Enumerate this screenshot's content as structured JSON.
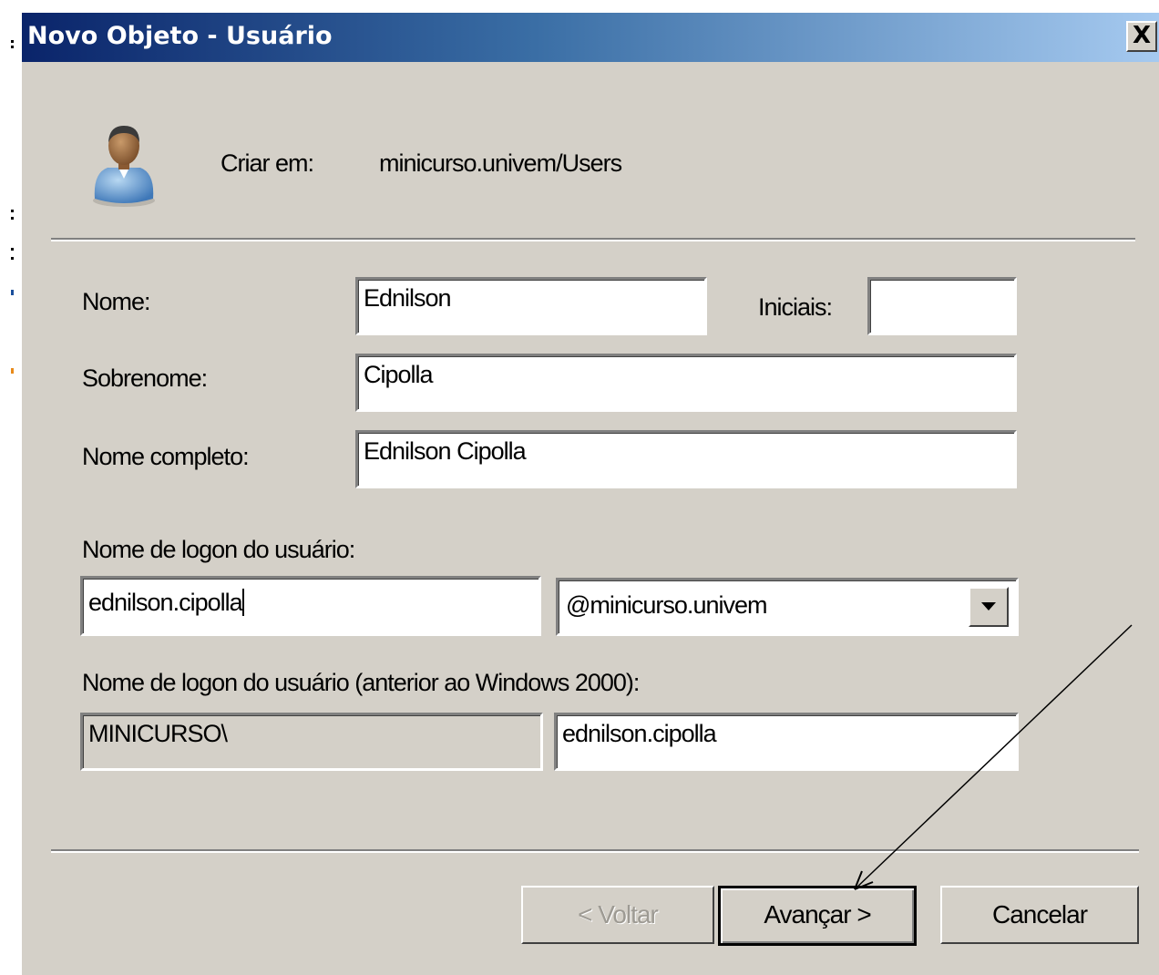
{
  "window": {
    "title": "Novo Objeto - Usuário",
    "close_glyph": "X"
  },
  "header": {
    "icon": "user-icon",
    "create_in_label": "Criar em:",
    "create_in_value": "minicurso.univem/Users"
  },
  "form": {
    "first_name_label": "Nome:",
    "first_name_value": "Ednilson",
    "initials_label": "Iniciais:",
    "initials_value": "",
    "last_name_label": "Sobrenome:",
    "last_name_value": "Cipolla",
    "full_name_label": "Nome completo:",
    "full_name_value": "Ednilson Cipolla",
    "logon_label": "Nome de logon do usuário:",
    "logon_value": "ednilson.cipolla",
    "domain_suffix_value": "@minicurso.univem",
    "pre2000_label": "Nome de logon do usuário (anterior ao Windows 2000):",
    "pre2000_domain_value": "MINICURSO\\",
    "pre2000_user_value": "ednilson.cipolla"
  },
  "buttons": {
    "back_label": "< Voltar",
    "next_label": "Avançar >",
    "cancel_label": "Cancelar"
  },
  "colors": {
    "dialog_bg": "#d4d0c8",
    "titlebar_start": "#0a246a",
    "titlebar_end": "#a6caf0"
  }
}
